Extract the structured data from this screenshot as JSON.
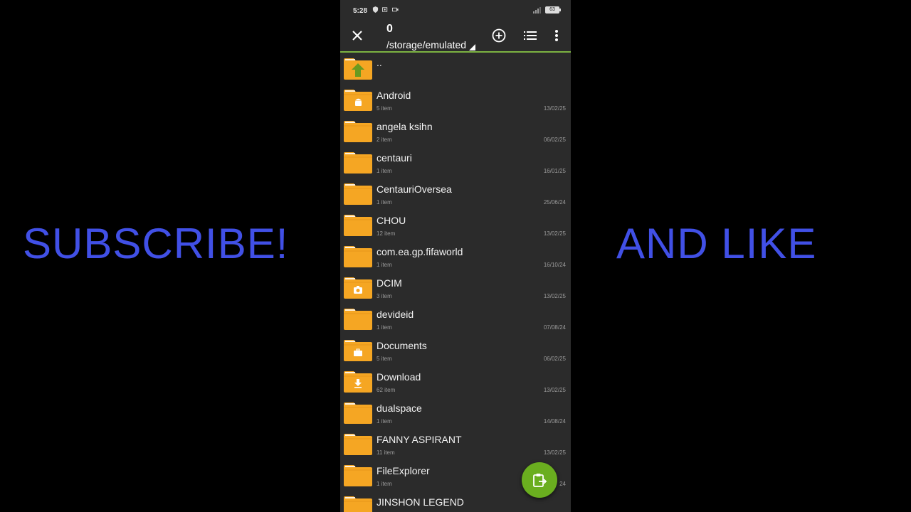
{
  "overlay": {
    "left_text": "SUBSCRIBE!",
    "right_text": "AND LIKE",
    "text_color": "#4150e6"
  },
  "status_bar": {
    "time": "5:28",
    "battery": "63",
    "icons": [
      "shield-icon",
      "record-icon",
      "camera-icon",
      "signal-icon",
      "battery-icon"
    ]
  },
  "toolbar": {
    "selection_count": "0",
    "path": "/storage/emulated",
    "accent": "#7cb342",
    "icons": [
      "close-icon",
      "add-circle-icon",
      "list-view-icon",
      "more-vert-icon"
    ]
  },
  "file_list": {
    "parent": "..",
    "folders": [
      {
        "name": "Android",
        "count": "5 item",
        "date": "13/02/25",
        "badge": "android"
      },
      {
        "name": "angela ksihn",
        "count": "2 item",
        "date": "06/02/25",
        "badge": ""
      },
      {
        "name": "centauri",
        "count": "1 item",
        "date": "16/01/25",
        "badge": ""
      },
      {
        "name": "CentauriOversea",
        "count": "1 item",
        "date": "25/06/24",
        "badge": ""
      },
      {
        "name": "CHOU",
        "count": "12 item",
        "date": "13/02/25",
        "badge": ""
      },
      {
        "name": "com.ea.gp.fifaworld",
        "count": "1 item",
        "date": "16/10/24",
        "badge": ""
      },
      {
        "name": "DCIM",
        "count": "3 item",
        "date": "13/02/25",
        "badge": "camera"
      },
      {
        "name": "devideid",
        "count": "1 item",
        "date": "07/08/24",
        "badge": ""
      },
      {
        "name": "Documents",
        "count": "5 item",
        "date": "06/02/25",
        "badge": "briefcase"
      },
      {
        "name": "Download",
        "count": "62 item",
        "date": "13/02/25",
        "badge": "download"
      },
      {
        "name": "dualspace",
        "count": "1 item",
        "date": "14/08/24",
        "badge": ""
      },
      {
        "name": "FANNY ASPIRANT",
        "count": "11 item",
        "date": "13/02/25",
        "badge": ""
      },
      {
        "name": "FileExplorer",
        "count": "1 item",
        "date": "24",
        "badge": ""
      },
      {
        "name": "JINSHON LEGEND",
        "count": "",
        "date": "",
        "badge": ""
      }
    ],
    "folder_color": "#f5a623"
  },
  "fab": {
    "icon": "paste-clipboard-icon",
    "color": "#6aae1f"
  }
}
